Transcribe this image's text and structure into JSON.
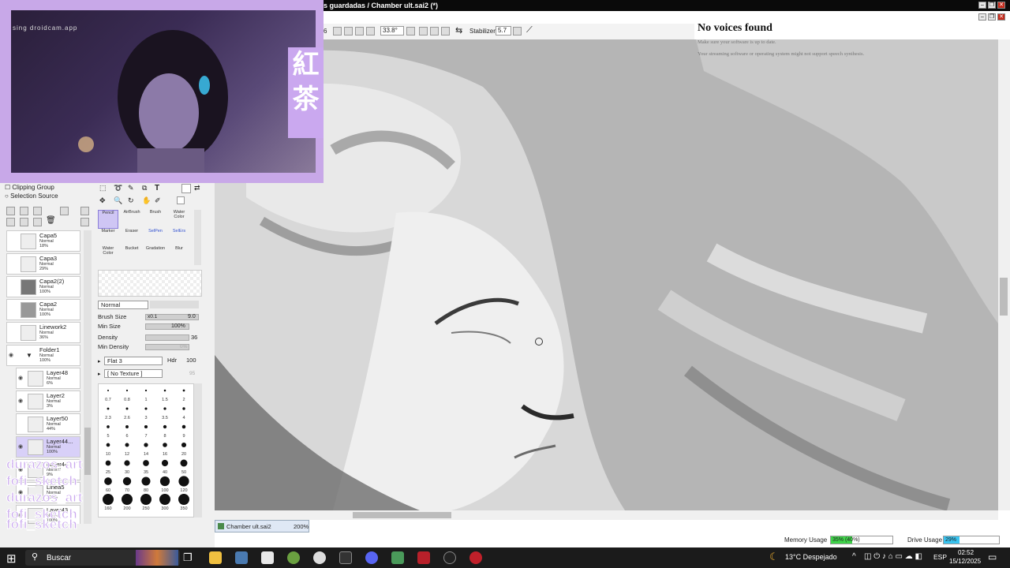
{
  "window": {
    "title": "s guardadas / Chamber ult.sai2 (*)"
  },
  "toolbar": {
    "zoom": "33.8°",
    "stabilizer_label": "Stabilizer",
    "stabilizer_value": "5.7",
    "left_value": "6"
  },
  "overlay": {
    "heading": "No voices found",
    "line1": "Make sure your software is up to date.",
    "line2": "Your streaming software or operating system might not support speech synthesis."
  },
  "webcam": {
    "url_text": "sing droidcam.app",
    "kanji": [
      "紅",
      "茶"
    ]
  },
  "selection": {
    "clipping_group": "Clipping Group",
    "selection_source": "Selection Source"
  },
  "layers": [
    {
      "name": "Capa5",
      "mode": "Normal",
      "opacity": "18%"
    },
    {
      "name": "Capa3",
      "mode": "Normal",
      "opacity": "29%"
    },
    {
      "name": "Capa2(2)",
      "mode": "Normal",
      "opacity": "100%"
    },
    {
      "name": "Capa2",
      "mode": "Normal",
      "opacity": "100%"
    },
    {
      "name": "Linework2",
      "mode": "Normal",
      "opacity": "36%"
    },
    {
      "name": "Folder1",
      "mode": "Normal",
      "opacity": "100%"
    },
    {
      "name": "Layer48",
      "mode": "Normal",
      "opacity": "6%"
    },
    {
      "name": "Layer2",
      "mode": "Normal",
      "opacity": "3%"
    },
    {
      "name": "Layer50",
      "mode": "Normal",
      "opacity": "44%"
    },
    {
      "name": "Layer44...",
      "mode": "Normal",
      "opacity": "100%"
    },
    {
      "name": "Layer44",
      "mode": "Normal",
      "opacity": "9%"
    },
    {
      "name": "Linea5",
      "mode": "Normal",
      "opacity": "100%"
    },
    {
      "name": "Layer43",
      "mode": "Normal",
      "opacity": "100%"
    }
  ],
  "tools": {
    "row1": [
      "Pencil",
      "AirBrush",
      "Brush",
      "Water Color"
    ],
    "row2": [
      "Marker",
      "Eraser",
      "SelPen",
      "SelErs"
    ],
    "row3": [
      "Water Color",
      "Bucket",
      "Gradation",
      "Blur"
    ]
  },
  "brush": {
    "blend_mode": "Normal",
    "brush_size_label": "Brush Size",
    "brush_size_mult": "x0.1",
    "brush_size_value": "9.0",
    "min_size_label": "Min Size",
    "min_size_value": "100%",
    "density_label": "Density",
    "density_value": "36",
    "min_density_label": "Min Density",
    "min_density_value": "0%",
    "shape": "Flat 3",
    "hardness_label": "Hdr",
    "hardness_value": "100",
    "texture": "[ No Texture ]",
    "texture_value": "95"
  },
  "brush_sizes": [
    [
      "0.7",
      "0.8",
      "1",
      "1.5",
      "2"
    ],
    [
      "2.3",
      "2.6",
      "3",
      "3.5",
      "4"
    ],
    [
      "5",
      "6",
      "7",
      "8",
      "9"
    ],
    [
      "10",
      "12",
      "14",
      "16",
      "20"
    ],
    [
      "25",
      "30",
      "35",
      "40",
      "50"
    ],
    [
      "60",
      "70",
      "80",
      "100",
      "120"
    ],
    [
      "160",
      "200",
      "250",
      "300",
      "350"
    ]
  ],
  "file_tab": {
    "name": "Chamber ult.sai2",
    "zoom": "200%"
  },
  "status": {
    "memory_label": "Memory Usage",
    "memory_value": "35% (40%)",
    "memory_fraction": 0.35,
    "drive_label": "Drive Usage",
    "drive_value": "29%",
    "drive_fraction": 0.29
  },
  "watermark": {
    "line1": "durazos_art",
    "line2": "fofi_sketch",
    "line3": "durazos_art",
    "line4": "fofi_sketch",
    "line5": "fofi_sketch"
  },
  "taskbar": {
    "search": "Buscar",
    "weather": "13°C  Despejado",
    "lang": "ESP",
    "time": "02:52",
    "date": "15/12/2025"
  },
  "colors": {
    "accent": "#caa8ef",
    "memory_bar": "#3fd44a",
    "drive_bar": "#39c4f0"
  }
}
